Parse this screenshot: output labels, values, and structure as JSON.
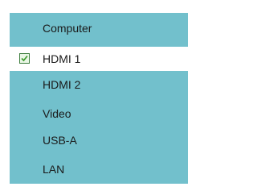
{
  "menu": {
    "items": [
      {
        "label": "Computer",
        "selected": false
      },
      {
        "label": "HDMI 1",
        "selected": true
      },
      {
        "label": "HDMI 2",
        "selected": false
      },
      {
        "label": "Video",
        "selected": false
      },
      {
        "label": "USB-A",
        "selected": false
      },
      {
        "label": "LAN",
        "selected": false
      }
    ]
  },
  "colors": {
    "menu_background": "#72c0cc",
    "selected_background": "#ffffff",
    "checkmark": "#3a9a2a"
  }
}
